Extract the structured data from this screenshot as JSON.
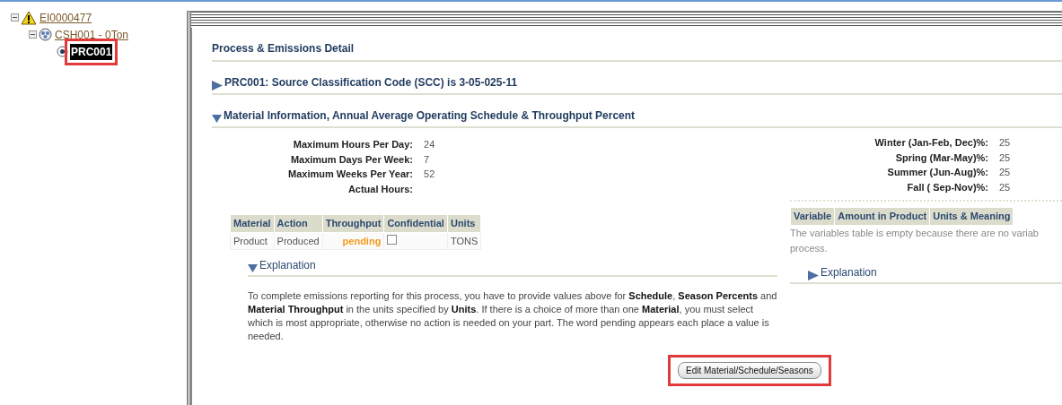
{
  "tree": [
    {
      "label": "EI0000477",
      "kind": "warning",
      "expanded": true,
      "selected": false,
      "highlighted": false,
      "children": [
        {
          "label": "CSH001 - 0Ton",
          "kind": "stack",
          "expanded": true,
          "selected": false,
          "highlighted": false,
          "children": [
            {
              "label": "PRC001",
              "kind": "radio",
              "selected": true,
              "highlighted": true
            }
          ]
        }
      ]
    }
  ],
  "page_title": "Process & Emissions Detail",
  "sections": [
    {
      "title": "PRC001: Source Classification Code (SCC) is 3-05-025-11",
      "expanded": false
    },
    {
      "title": "Material Information, Annual Average Operating Schedule & Throughput Percent",
      "expanded": true
    }
  ],
  "schedule": [
    {
      "label": "Maximum Hours Per Day:",
      "value": "24"
    },
    {
      "label": "Maximum Days Per Week:",
      "value": "7"
    },
    {
      "label": "Maximum Weeks Per Year:",
      "value": "52"
    },
    {
      "label": "Actual Hours:"
    }
  ],
  "seasons": [
    {
      "label": "Winter (Jan-Feb, Dec)%:",
      "value": "25"
    },
    {
      "label": "Spring (Mar-May)%:",
      "value": "25"
    },
    {
      "label": "Summer (Jun-Aug)%:",
      "value": "25"
    },
    {
      "label": "Fall ( Sep-Nov)%:",
      "value": "25"
    }
  ],
  "material_table": {
    "columns": [
      "Material",
      "Action",
      "Throughput",
      "Confidential",
      "Units"
    ],
    "rows": [
      {
        "material": "Product",
        "action": "Produced",
        "throughput": "pending",
        "confidential": false,
        "units": "TONS"
      }
    ]
  },
  "variables_table": {
    "columns": [
      "Variable",
      "Amount in Product",
      "Units & Meaning"
    ],
    "empty_lines": [
      "The variables table is empty because there are no variab",
      "process."
    ]
  },
  "explanations": [
    {
      "title": "Explanation",
      "expanded": true,
      "text": "To complete emissions reporting for this process, you have to provide values above for **Schedule**, **Season Percents** and **Material Throughput** in the units specified by **Units**. If there is a choice of more than one **Material**, you must select which is most appropriate, otherwise no action is needed on your part. The word pending appears each place a value is needed."
    },
    {
      "title": "Explanation",
      "expanded": false
    }
  ],
  "edit_button": {
    "label": "Edit Material/Schedule/Seasons",
    "highlighted": true
  }
}
